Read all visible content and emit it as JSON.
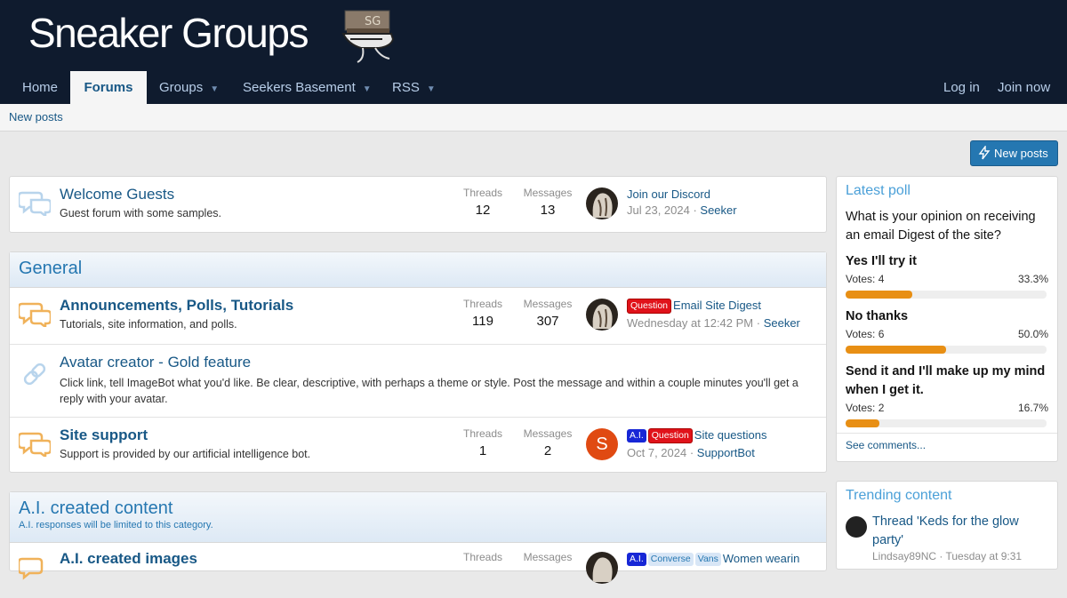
{
  "site": {
    "title": "Sneaker Groups",
    "logo_text": "SG"
  },
  "nav": {
    "items": [
      {
        "label": "Home"
      },
      {
        "label": "Forums"
      },
      {
        "label": "Groups"
      },
      {
        "label": "Seekers Basement"
      },
      {
        "label": "RSS"
      }
    ],
    "login": "Log in",
    "join": "Join now"
  },
  "subnav": {
    "new_posts": "New posts"
  },
  "button": {
    "new_posts": "New posts"
  },
  "welcome": {
    "title": "Welcome Guests",
    "desc": "Guest forum with some samples.",
    "threads_label": "Threads",
    "threads": "12",
    "messages_label": "Messages",
    "messages": "13",
    "last_title": "Join our Discord",
    "last_date": "Jul 23, 2024",
    "last_user": "Seeker"
  },
  "general": {
    "title": "General",
    "nodes": [
      {
        "title": "Announcements, Polls, Tutorials",
        "desc": "Tutorials, site information, and polls.",
        "threads_label": "Threads",
        "threads": "119",
        "messages_label": "Messages",
        "messages": "307",
        "prefix": "Question",
        "last_title": "Email Site Digest",
        "last_date": "Wednesday at 12:42 PM",
        "last_user": "Seeker"
      },
      {
        "title": "Avatar creator - Gold feature",
        "desc": "Click link, tell ImageBot what you'd like. Be clear, descriptive, with perhaps a theme or style. Post the message and within a couple minutes you'll get a reply with your avatar."
      },
      {
        "title": "Site support",
        "desc": "Support is provided by our artificial intelligence bot.",
        "threads_label": "Threads",
        "threads": "1",
        "messages_label": "Messages",
        "messages": "2",
        "prefix1": "A.I.",
        "prefix2": "Question",
        "last_title": "Site questions",
        "last_date": "Oct 7, 2024",
        "last_user": "SupportBot",
        "avatar_letter": "S"
      }
    ]
  },
  "ai": {
    "title": "A.I. created content",
    "desc": "A.I. responses will be limited to this category.",
    "node": {
      "title": "A.I. created images",
      "threads_label": "Threads",
      "messages_label": "Messages",
      "prefix1": "A.I.",
      "prefix2": "Converse",
      "prefix3": "Vans",
      "last_title": "Women wearin"
    }
  },
  "poll": {
    "heading": "Latest poll",
    "question": "What is your opinion on receiving an email Digest of the site?",
    "options": [
      {
        "name": "Yes I'll try it",
        "votes": "Votes: 4",
        "pct": "33.3%",
        "value": 33.3
      },
      {
        "name": "No thanks",
        "votes": "Votes: 6",
        "pct": "50.0%",
        "value": 50.0
      },
      {
        "name": "Send it and I'll make up my mind when I get it.",
        "votes": "Votes: 2",
        "pct": "16.7%",
        "value": 16.7
      }
    ],
    "footer": "See comments..."
  },
  "trending": {
    "heading": "Trending content",
    "item_title": "Thread 'Keds for the glow party'",
    "item_meta": "Lindsay89NC · Tuesday at 9:31"
  },
  "colors": {
    "header_bg": "#0f1b2e",
    "link": "#185886",
    "accent": "#2577b1",
    "poll_fill": "#e88f14",
    "label_red": "#e0121a",
    "label_blue": "#1727d6"
  }
}
